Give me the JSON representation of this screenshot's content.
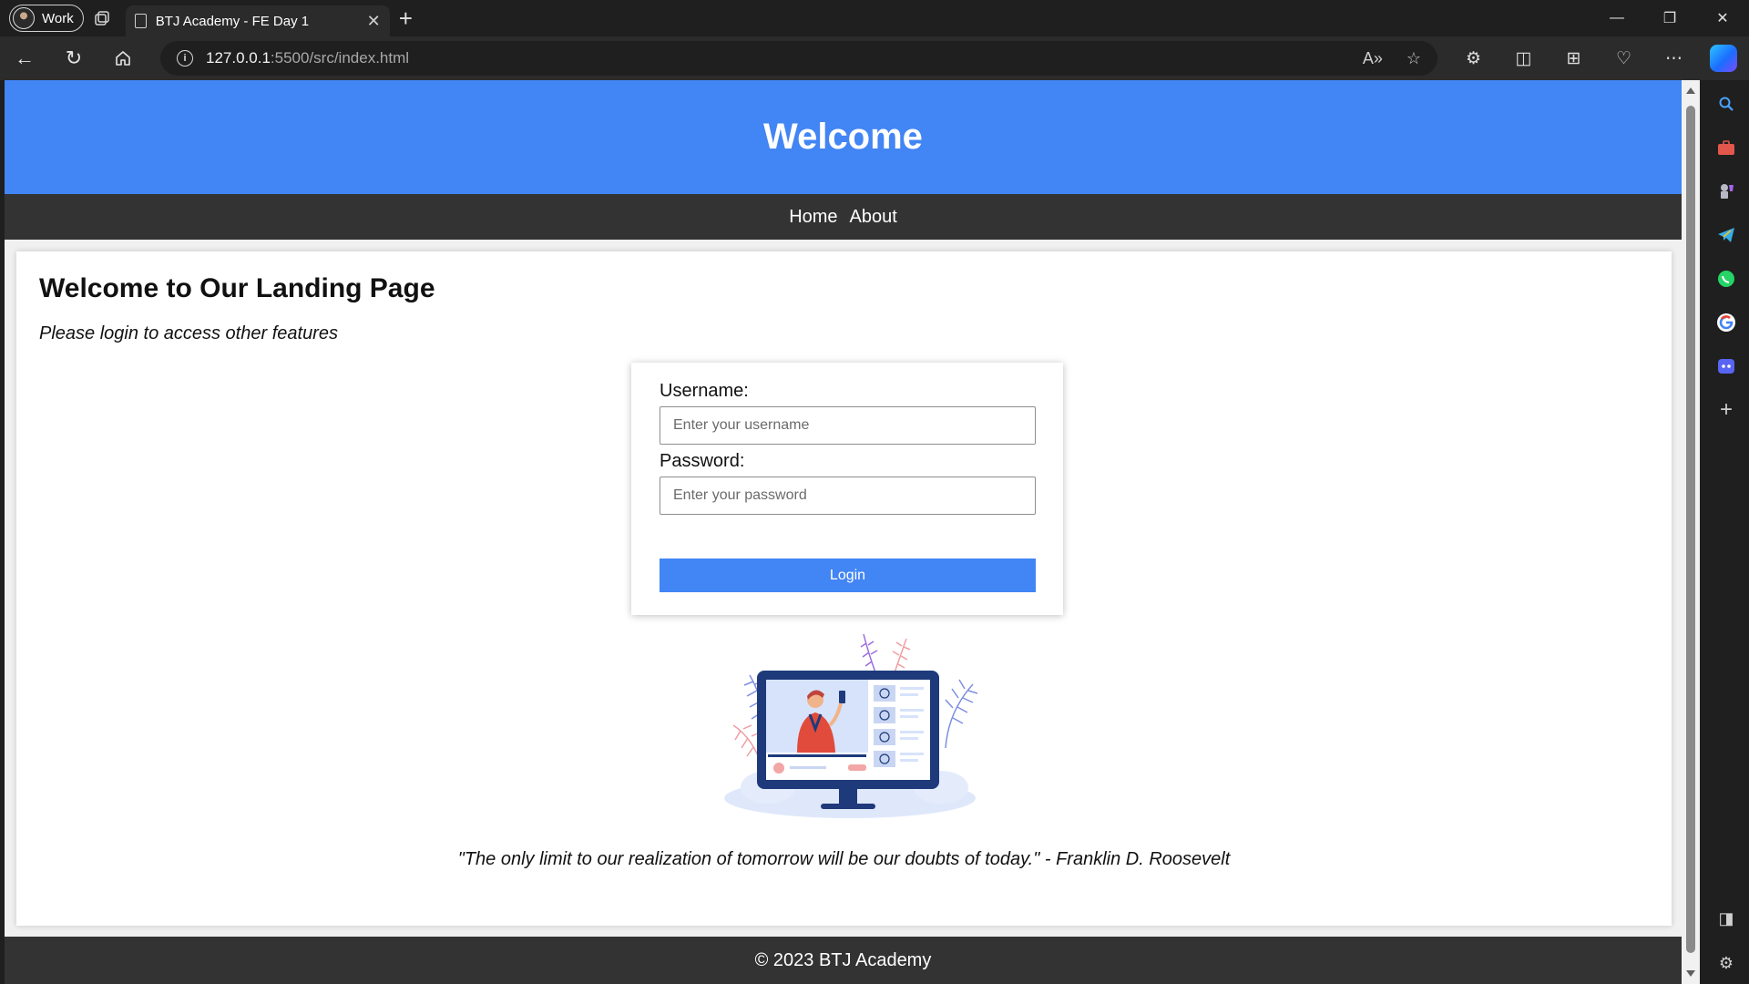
{
  "browser": {
    "profile_label": "Work",
    "tab_title": "BTJ Academy - FE Day 1",
    "url_host": "127.0.0.1",
    "url_path": ":5500/src/index.html"
  },
  "site": {
    "header_title": "Welcome",
    "nav": [
      {
        "label": "Home"
      },
      {
        "label": "About"
      }
    ],
    "heading": "Welcome to Our Landing Page",
    "subtitle": "Please login to access other features",
    "login": {
      "username_label": "Username:",
      "username_placeholder": "Enter your username",
      "password_label": "Password:",
      "password_placeholder": "Enter your password",
      "button_label": "Login"
    },
    "quote": "\"The only limit to our realization of tomorrow will be our doubts of today.\" - Franklin D. Roosevelt",
    "footer": "© 2023 BTJ Academy"
  },
  "colors": {
    "brand_blue": "#4285f4",
    "dark_bar": "#333333"
  },
  "sidebar_icons": [
    "search-icon",
    "briefcase-icon",
    "chess-icon",
    "telegram-icon",
    "whatsapp-icon",
    "google-icon",
    "discord-icon",
    "add-icon"
  ]
}
